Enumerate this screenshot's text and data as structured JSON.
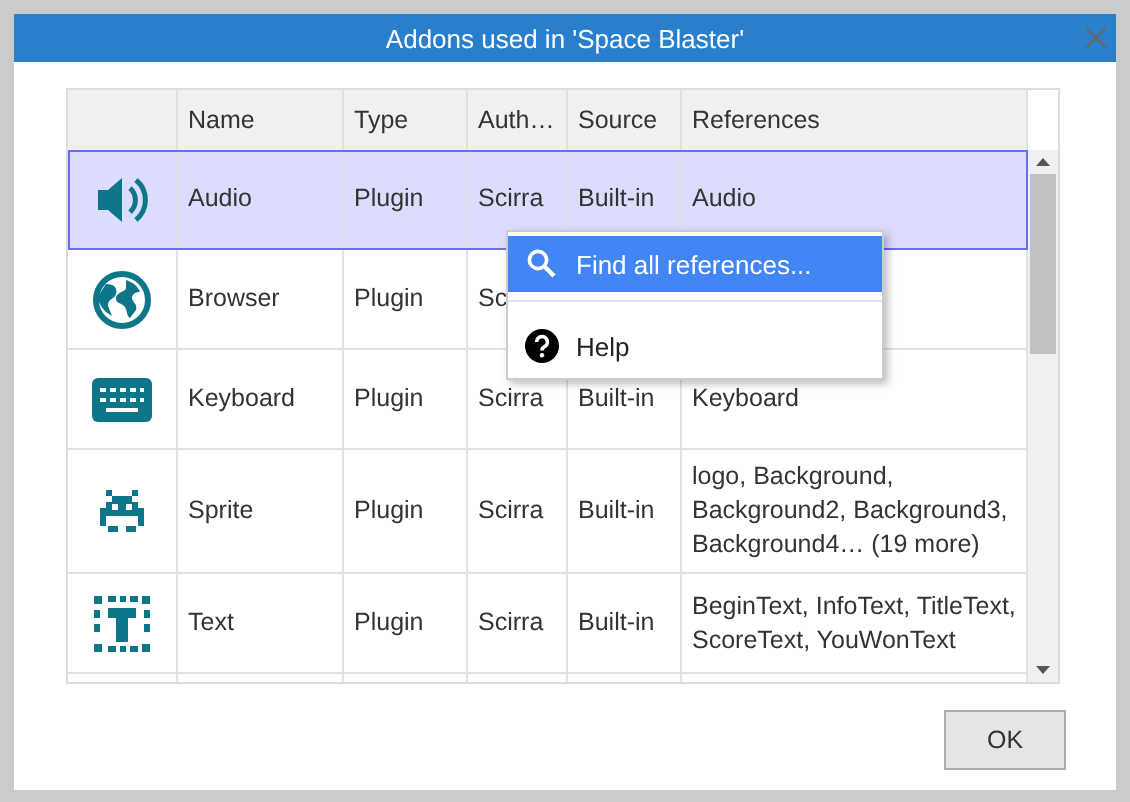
{
  "window": {
    "title": "Addons used in 'Space Blaster'"
  },
  "table": {
    "columns": [
      "Name",
      "Type",
      "Auth…",
      "Source",
      "References"
    ],
    "rows": [
      {
        "name": "Audio",
        "type": "Plugin",
        "author": "Scirra",
        "source": "Built-in",
        "references": "Audio",
        "selected": true
      },
      {
        "name": "Browser",
        "type": "Plugin",
        "author": "Sc",
        "selected": false
      },
      {
        "name": "Keyboard",
        "type": "Plugin",
        "author": "Scirra",
        "source": "Built-in",
        "references": "Keyboard",
        "selected": false
      },
      {
        "name": "Sprite",
        "type": "Plugin",
        "author": "Scirra",
        "source": "Built-in",
        "references": "logo, Background, Background2, Background3, Background4… (19 more)",
        "selected": false
      },
      {
        "name": "Text",
        "type": "Plugin",
        "author": "Scirra",
        "source": "Built-in",
        "references": "BeginText, InfoText, TitleText, ScoreText, YouWonText",
        "selected": false
      }
    ]
  },
  "context_menu": {
    "items": [
      {
        "kind": "search",
        "label": "Find all references...",
        "selected": true
      },
      {
        "kind": "help",
        "label": "Help",
        "selected": false
      }
    ]
  },
  "buttons": [
    "OK"
  ]
}
